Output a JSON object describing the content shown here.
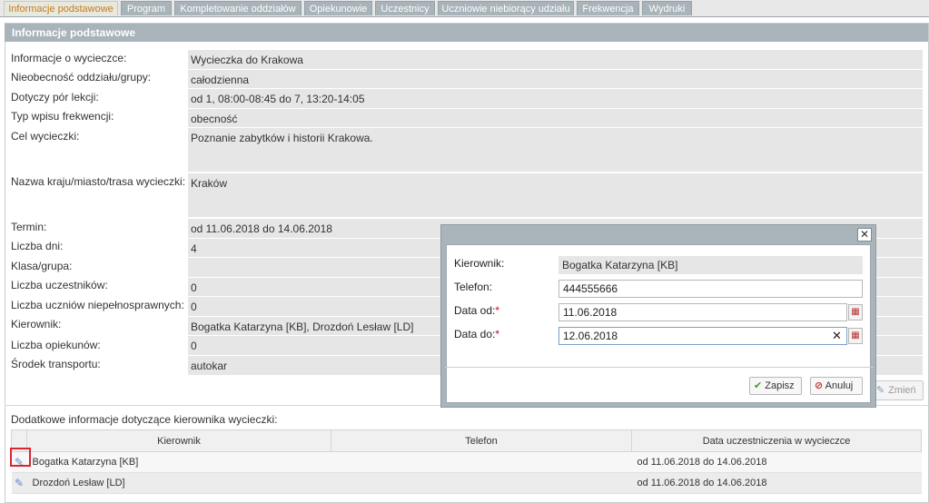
{
  "tabs": [
    {
      "label": "Informacje podstawowe",
      "active": true
    },
    {
      "label": "Program"
    },
    {
      "label": "Kompletowanie oddziałów"
    },
    {
      "label": "Opiekunowie"
    },
    {
      "label": "Uczestnicy"
    },
    {
      "label": "Uczniowie niebiorący udziału"
    },
    {
      "label": "Frekwencja"
    },
    {
      "label": "Wydruki"
    }
  ],
  "panel_title": "Informacje podstawowe",
  "fields": [
    {
      "label": "Informacje o wycieczce:",
      "value": "Wycieczka do Krakowa"
    },
    {
      "label": "Nieobecność oddziału/grupy:",
      "value": "całodzienna"
    },
    {
      "label": "Dotyczy pór lekcji:",
      "value": "od 1, 08:00-08:45 do 7, 13:20-14:05"
    },
    {
      "label": "Typ wpisu frekwencji:",
      "value": "obecność"
    },
    {
      "label": "Cel wycieczki:",
      "value": "Poznanie zabytków i historii Krakowa."
    },
    {
      "label": "Nazwa kraju/miasto/trasa wycieczki:",
      "value": "Kraków"
    },
    {
      "label": "Termin:",
      "value": "od 11.06.2018 do 14.06.2018"
    },
    {
      "label": "Liczba dni:",
      "value": "4"
    },
    {
      "label": "Klasa/grupa:",
      "value": ""
    },
    {
      "label": "Liczba uczestników:",
      "value": "0"
    },
    {
      "label": "Liczba uczniów niepełnosprawnych:",
      "value": "0"
    },
    {
      "label": "Kierownik:",
      "value": "Bogatka Katarzyna [KB], Drozdoń Lesław [LD]"
    },
    {
      "label": "Liczba opiekunów:",
      "value": "0"
    },
    {
      "label": "Środek transportu:",
      "value": "autokar"
    }
  ],
  "change_button": "Zmień",
  "section_title": "Dodatkowe informacje dotyczące kierownika wycieczki:",
  "table": {
    "headers": [
      "Kierownik",
      "Telefon",
      "Data uczestniczenia w wycieczce"
    ],
    "rows": [
      {
        "kierownik": "Bogatka Katarzyna [KB]",
        "telefon": "",
        "data": "od 11.06.2018 do 14.06.2018"
      },
      {
        "kierownik": "Drozdoń Lesław [LD]",
        "telefon": "",
        "data": "od 11.06.2018 do 14.06.2018"
      }
    ]
  },
  "modal": {
    "kierownik_label": "Kierownik:",
    "kierownik_value": "Bogatka Katarzyna [KB]",
    "telefon_label": "Telefon:",
    "telefon_value": "444555666",
    "data_od_label": "Data od:",
    "data_od_value": "11.06.2018",
    "data_do_label": "Data do:",
    "data_do_value": "12.06.2018",
    "required_mark": "*",
    "save_label": "Zapisz",
    "cancel_label": "Anuluj"
  },
  "icons": {
    "pencil": "pencil-icon",
    "close": "close-icon",
    "calendar": "calendar-icon",
    "check": "checkmark-icon",
    "cancel": "no-entry-icon"
  },
  "colors": {
    "active_tab_text": "#c77a1e",
    "header_bg": "#a8b3ba",
    "highlight": "#d9262f",
    "required": "#d0021b"
  }
}
